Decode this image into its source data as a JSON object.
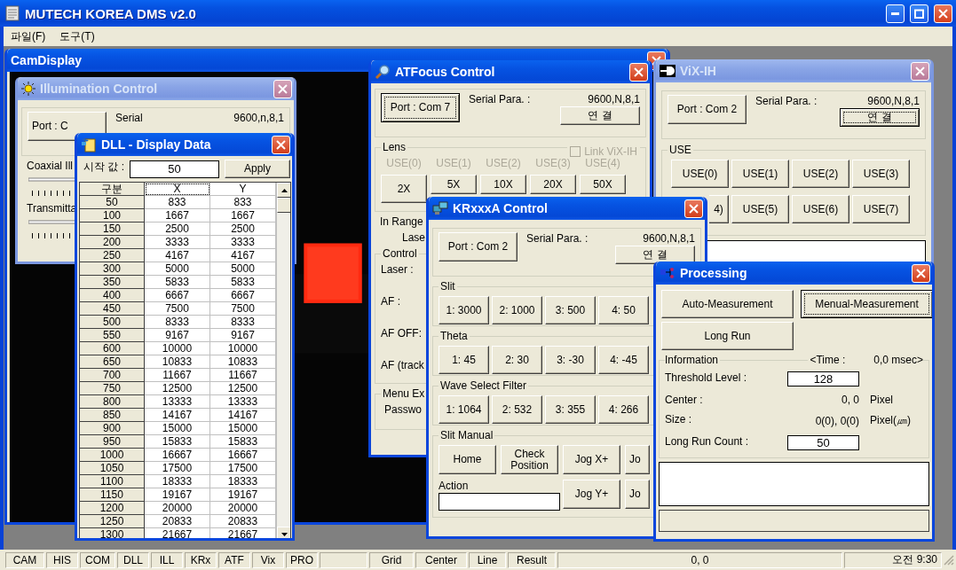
{
  "window": {
    "title": "MUTECH KOREA DMS v2.0",
    "active": true
  },
  "menu": [
    {
      "label": "파일(F)"
    },
    {
      "label": "도구(T)"
    }
  ],
  "cam_display": {
    "title": "CamDisplay",
    "active": true
  },
  "illumination": {
    "title": "Illumination Control",
    "active": false,
    "port_button": "Port : C",
    "serial_label": "Serial",
    "serial_value": "9600,n,8,1",
    "coaxial_label": "Coaxial Ill",
    "transmittance_label": "Transmitta"
  },
  "dll": {
    "title": "DLL - Display Data",
    "active": true,
    "start_label": "시작 값 :",
    "start_value": "50",
    "apply_button": "Apply",
    "columns": [
      "구분",
      "X",
      "Y"
    ],
    "rows": [
      [
        "50",
        "833",
        "833"
      ],
      [
        "100",
        "1667",
        "1667"
      ],
      [
        "150",
        "2500",
        "2500"
      ],
      [
        "200",
        "3333",
        "3333"
      ],
      [
        "250",
        "4167",
        "4167"
      ],
      [
        "300",
        "5000",
        "5000"
      ],
      [
        "350",
        "5833",
        "5833"
      ],
      [
        "400",
        "6667",
        "6667"
      ],
      [
        "450",
        "7500",
        "7500"
      ],
      [
        "500",
        "8333",
        "8333"
      ],
      [
        "550",
        "9167",
        "9167"
      ],
      [
        "600",
        "10000",
        "10000"
      ],
      [
        "650",
        "10833",
        "10833"
      ],
      [
        "700",
        "11667",
        "11667"
      ],
      [
        "750",
        "12500",
        "12500"
      ],
      [
        "800",
        "13333",
        "13333"
      ],
      [
        "850",
        "14167",
        "14167"
      ],
      [
        "900",
        "15000",
        "15000"
      ],
      [
        "950",
        "15833",
        "15833"
      ],
      [
        "1000",
        "16667",
        "16667"
      ],
      [
        "1050",
        "17500",
        "17500"
      ],
      [
        "1100",
        "18333",
        "18333"
      ],
      [
        "1150",
        "19167",
        "19167"
      ],
      [
        "1200",
        "20000",
        "20000"
      ],
      [
        "1250",
        "20833",
        "20833"
      ],
      [
        "1300",
        "21667",
        "21667"
      ]
    ]
  },
  "atfocus": {
    "title": "ATFocus Control",
    "active": true,
    "port_button": {
      "label": "Port : Com 7",
      "focused": true
    },
    "serial_label": "Serial Para. :",
    "serial_value": "9600,N,8,1",
    "connect_button": {
      "label": "연 결",
      "focused": false
    },
    "lens": {
      "label": "Lens",
      "disabled": true,
      "link_label": "Link ViX-IH",
      "link_checked": false,
      "use_labels": [
        "USE(0)",
        "USE(1)",
        "USE(2)",
        "USE(3)",
        "USE(4)"
      ],
      "buttons": [
        "2X",
        "5X",
        "10X",
        "20X",
        "50X"
      ]
    },
    "in_range_label": "In Range",
    "laser_label": "Lase",
    "control": {
      "label": "Control",
      "rows": [
        "Laser :",
        "AF :",
        "AF OFF:",
        "AF (track"
      ]
    },
    "menu_group": {
      "label": "Menu Ex",
      "password_label": "Passwo"
    }
  },
  "vix": {
    "title": "ViX-IH",
    "active": false,
    "port_button": {
      "label": "Port : Com 2",
      "focused": false
    },
    "serial_label": "Serial Para. :",
    "serial_value": "9600,N,8,1",
    "connect_button": {
      "label": "연 결",
      "focused": true
    },
    "use_group": {
      "label": "USE",
      "buttons": [
        {
          "label": "USE(0)",
          "kind": "full"
        },
        {
          "label": "USE(1)",
          "kind": "full"
        },
        {
          "label": "USE(2)",
          "kind": "full"
        },
        {
          "label": "USE(3)",
          "kind": "full"
        },
        {
          "label": "4)",
          "kind": "clipped"
        },
        {
          "label": "USE(5)",
          "kind": "full"
        },
        {
          "label": "USE(6)",
          "kind": "full"
        },
        {
          "label": "USE(7)",
          "kind": "full"
        }
      ]
    }
  },
  "krxxxa": {
    "title": "KRxxxA Control",
    "active": true,
    "port_button": {
      "label": "Port : Com 2",
      "focused": false
    },
    "serial_label": "Serial Para. :",
    "serial_value": "9600,N,8,1",
    "connect_button": {
      "label": "연 결",
      "focused": false
    },
    "groups": [
      {
        "label": "Slit",
        "buttons": [
          "1: 3000",
          "2: 1000",
          "3: 500",
          "4: 50"
        ]
      },
      {
        "label": "Theta",
        "buttons": [
          "1: 45",
          "2: 30",
          "3: -30",
          "4: -45"
        ]
      },
      {
        "label": "Wave Select Filter",
        "buttons": [
          "1: 1064",
          "2: 532",
          "3: 355",
          "4: 266"
        ]
      }
    ],
    "slit_manual": {
      "label": "Slit Manual",
      "home_button": "Home",
      "check_button": "Check Position",
      "jog_x_button": "Jog X+",
      "jog_x_clipped": "Jo",
      "action_label": "Action",
      "jog_y_button": "Jog Y+",
      "jog_y_clipped": "Jo"
    }
  },
  "processing": {
    "title": "Processing",
    "active": true,
    "buttons": [
      {
        "label": "Auto-Measurement",
        "focused": false
      },
      {
        "label": "Menual-Measurement",
        "focused": true
      },
      {
        "label": "Long Run",
        "focused": false
      }
    ],
    "info": {
      "label": "Information",
      "time_label": "<Time :",
      "time_value": "0,0 msec>",
      "threshold_label": "Threshold Level :",
      "threshold_value": "128",
      "center_label": "Center :",
      "center_value": "0, 0",
      "center_unit": "Pixel",
      "size_label": "Size :",
      "size_value": "0(0), 0(0)",
      "size_unit": "Pixel(㎛)",
      "count_label": "Long Run Count :",
      "count_value": "50"
    }
  },
  "status_bar": {
    "tabs": [
      {
        "label": "CAM"
      },
      {
        "label": "HIS"
      },
      {
        "label": "COM"
      },
      {
        "label": "DLL"
      },
      {
        "label": "ILL"
      },
      {
        "label": "KRx"
      },
      {
        "label": "ATF"
      },
      {
        "label": "Vix"
      },
      {
        "label": "PRO"
      }
    ],
    "tools": [
      {
        "label": "Grid"
      },
      {
        "label": "Center"
      },
      {
        "label": "Line"
      },
      {
        "label": "Result"
      }
    ],
    "coords": "0, 0",
    "clock": "오전 9:30"
  }
}
